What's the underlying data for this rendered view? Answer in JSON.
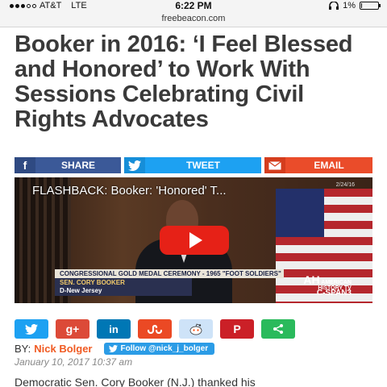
{
  "status_bar": {
    "carrier": "AT&T",
    "network": "LTE",
    "time": "6:22 PM",
    "battery": "1%",
    "battery_level": 0.01
  },
  "browser": {
    "url": "freebeacon.com"
  },
  "article": {
    "headline": "Booker in 2016: ‘I Feel Blessed and Honored’ to Work With Sessions Celebrating Civil Rights Advocates",
    "byline_prefix": "BY:",
    "author": "Nick Bolger",
    "follow_label": "Follow @nick_j_bolger",
    "date": "January 10, 2017 10:37 am",
    "body_start": "Democratic Sen. Cory Booker (N.J.) thanked his"
  },
  "share_bar": {
    "facebook": {
      "icon": "facebook-icon",
      "label": "SHARE",
      "color": "#3b5998"
    },
    "twitter": {
      "icon": "twitter-icon",
      "label": "TWEET",
      "color": "#1da1f2"
    },
    "email": {
      "icon": "email-icon",
      "label": "EMAIL",
      "color": "#ea4c2a"
    }
  },
  "video": {
    "title": "FLASHBACK: Booker: 'Honored' T...",
    "date_stamp": "2/24/16",
    "chyron": "CONGRESSIONAL GOLD MEDAL CEREMONY - 1965 \"FOOT SOLDIERS\"",
    "speaker_name": "SEN. CORY BOOKER",
    "speaker_info": "D-New Jersey",
    "network_logo_line1": "AMERICAN",
    "network_logo_line2": "HISTORY TV",
    "network_logo_big": "AH",
    "channel": "C-SPAN3"
  },
  "social_icons": [
    {
      "name": "twitter-icon",
      "glyph": "🐦",
      "color": "#1da1f2"
    },
    {
      "name": "google-plus-icon",
      "glyph": "g+",
      "color": "#dc4a38"
    },
    {
      "name": "linkedin-icon",
      "glyph": "in",
      "color": "#0077b5"
    },
    {
      "name": "stumbleupon-icon",
      "glyph": "su",
      "color": "#eb4924"
    },
    {
      "name": "reddit-icon",
      "glyph": "👽",
      "color": "#cee3f8"
    },
    {
      "name": "pinterest-icon",
      "glyph": "P",
      "color": "#cb2027"
    },
    {
      "name": "share-icon",
      "glyph": "<",
      "color": "#2aba5c"
    }
  ]
}
